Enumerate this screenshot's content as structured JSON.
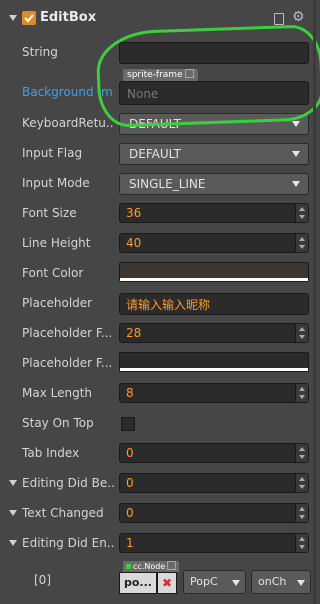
{
  "header": {
    "title": "EditBox"
  },
  "rows": {
    "string": {
      "label": "String",
      "value": ""
    },
    "background_image": {
      "label": "Background Im...",
      "asset_type": "sprite-frame",
      "value": "None"
    },
    "keyboard_return": {
      "label": "KeyboardRetu...",
      "value": "DEFAULT"
    },
    "input_flag": {
      "label": "Input Flag",
      "value": "DEFAULT"
    },
    "input_mode": {
      "label": "Input Mode",
      "value": "SINGLE_LINE"
    },
    "font_size": {
      "label": "Font Size",
      "value": "36"
    },
    "line_height": {
      "label": "Line Height",
      "value": "40"
    },
    "font_color": {
      "label": "Font Color",
      "color": "#3d3530"
    },
    "placeholder": {
      "label": "Placeholder",
      "value": "请输入输入昵称"
    },
    "placeholder_font_size": {
      "label": "Placeholder F...",
      "value": "28"
    },
    "placeholder_font_color": {
      "label": "Placeholder F...",
      "color": "#2b2b2b"
    },
    "max_length": {
      "label": "Max Length",
      "value": "8"
    },
    "stay_on_top": {
      "label": "Stay On Top",
      "checked": false
    },
    "tab_index": {
      "label": "Tab Index",
      "value": "0"
    },
    "editing_did_begin": {
      "label": "Editing Did Be...",
      "value": "0"
    },
    "text_changed": {
      "label": "Text Changed",
      "value": "0"
    },
    "editing_did_end": {
      "label": "Editing Did En...",
      "value": "1"
    }
  },
  "event_item": {
    "index_label": "[0]",
    "node_type": "cc.Node",
    "node_value": "po...",
    "remove_glyph": "✖",
    "component_value": "PopC",
    "handler_value": "onCh"
  }
}
